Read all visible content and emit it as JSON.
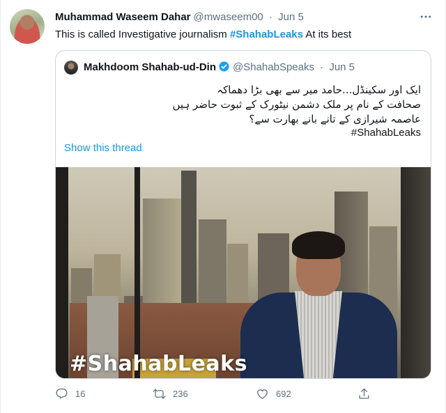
{
  "tweet": {
    "author_name": "Muhammad Waseem Dahar",
    "author_handle": "@mwaseem00",
    "date": "Jun 5",
    "text_before": "This is called Investigative journalism ",
    "hashtag": "#ShahabLeaks",
    "text_after": " At its best",
    "more_icon": "more-icon"
  },
  "quote": {
    "author_name": "Makhdoom Shahab-ud-Din",
    "author_handle": "@ShahabSpeaks",
    "date": "Jun 5",
    "urdu_lines": [
      "ایک اور سکینڈل...حامد میر سے بھی بڑا دھماکہ",
      "صحافت کے نام پر ملک دشمن نیٹورک کے ثبوت حاضر ہیں",
      "عاصمہ شیرازی کے تانے بانے بھارت سے؟"
    ],
    "hashtag": "#ShahabLeaks",
    "show_thread": "Show this thread",
    "media_watermark": "#ShahabLeaks"
  },
  "actions": {
    "reply_count": "16",
    "retweet_count": "236",
    "like_count": "692"
  },
  "colors": {
    "accent": "#1b95e0",
    "muted": "#5b7083",
    "verified": "#1da1f2"
  }
}
